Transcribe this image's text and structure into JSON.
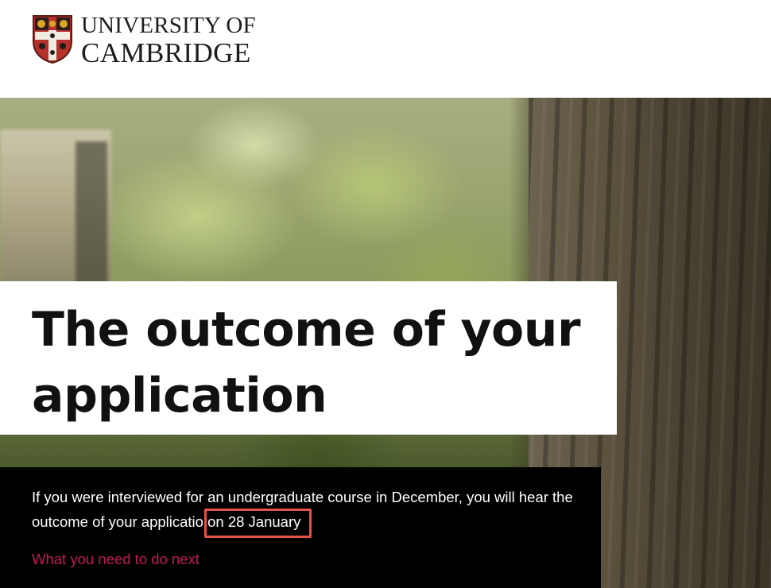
{
  "header": {
    "logo_line1": "UNIVERSITY OF",
    "logo_line2": "CAMBRIDGE"
  },
  "hero": {
    "title": "The outcome of your application"
  },
  "info": {
    "text": "If you were interviewed for an undergraduate course in December, you will hear the outcome of your applicatio",
    "highlighted_text": "on 28 January",
    "link_label": "What you need to do next"
  },
  "colors": {
    "link": "#c2185b",
    "highlight_box": "#e8504a",
    "panel": "#000000"
  },
  "icons": {
    "crest": "cambridge-crest-icon"
  }
}
